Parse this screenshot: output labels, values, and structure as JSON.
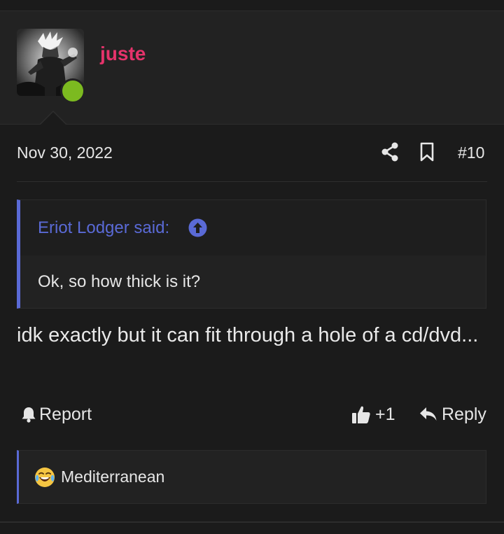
{
  "colors": {
    "background": "#1b1b1b",
    "username": "#e5336b",
    "quote_accent": "#5a6ad6",
    "online": "#7cba20"
  },
  "user": {
    "name": "juste",
    "online": true,
    "avatar_icon": "avatar-image"
  },
  "post": {
    "date": "Nov 30, 2022",
    "number": "#10",
    "share_icon": "share-icon",
    "bookmark_icon": "bookmark-icon",
    "body": "idk exactly but it can fit through a hole of a cd/dvd..."
  },
  "quote": {
    "author": "Eriot Lodger said:",
    "arrow_icon": "arrow-up-circle-icon",
    "text": "Ok, so how thick is it?"
  },
  "actions": {
    "report_label": "Report",
    "like_count": "+1",
    "reply_label": "Reply"
  },
  "reactions": {
    "emoji": "crying-laughing-emoji",
    "users": "Mediterranean"
  }
}
